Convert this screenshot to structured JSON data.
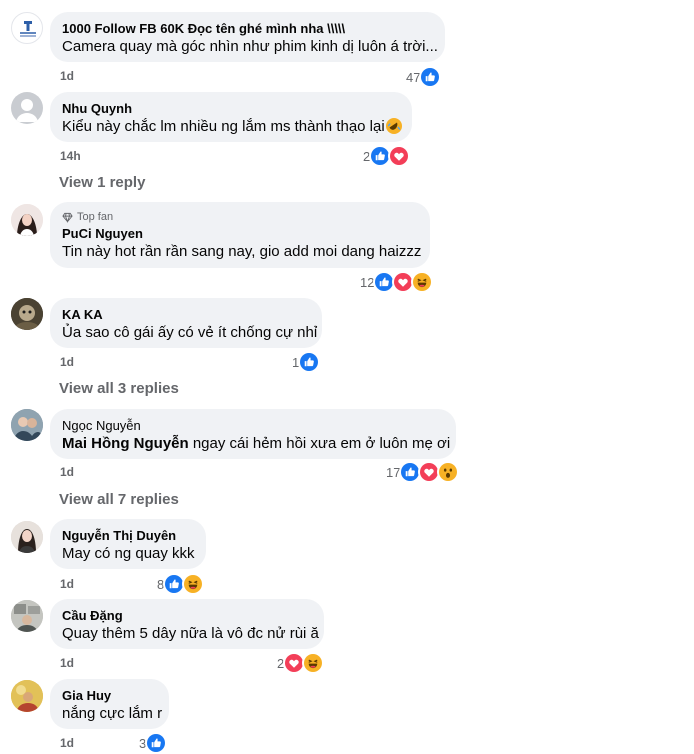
{
  "comments": [
    {
      "author": "1000 Follow FB 60K Đọc tên ghé mình nha \\\\\\\\\\",
      "text": "Camera quay mà góc nhìn như phim kinh dị luôn á trời...",
      "time": "1d",
      "count": "47",
      "avatar": "page-logo"
    },
    {
      "author": "Nhu Quynh",
      "text": "Kiểu này chắc lm nhiều ng lắm ms thành thạo lại",
      "time": "14h",
      "count": "2",
      "avatar": "default-avatar"
    },
    {
      "author": "PuCi Nguyen",
      "badge": "Top fan",
      "text": "Tin này hot rần rần sang nay, gio add moi dang haizzz",
      "time": "",
      "count": "12",
      "avatar": "user-photo"
    },
    {
      "author": "KA KA",
      "text": "Ủa sao cô gái ấy có vẻ ít chống cự nhỉ",
      "time": "1d",
      "count": "1",
      "avatar": "user-photo"
    },
    {
      "author": "Ngọc Nguyễn",
      "mention": "Mai Hồng Nguyễn",
      "text": " ngay cái hẻm hồi xưa em ở luôn mẹ ơi",
      "time": "1d",
      "count": "17",
      "avatar": "user-photo"
    },
    {
      "author": "Nguyễn Thị Duyên",
      "text": "May có ng quay kkk",
      "time": "1d",
      "count": "8",
      "avatar": "user-photo"
    },
    {
      "author": "Cầu Đặng",
      "text": "Quay thêm 5 dây nữa là vô đc nử rùi ă",
      "time": "1d",
      "count": "2",
      "avatar": "user-photo"
    },
    {
      "author": "Gia Huy",
      "text": "nắng cực lắm r",
      "time": "1d",
      "count": "3",
      "avatar": "user-photo"
    }
  ],
  "replies": {
    "r1": "View 1 reply",
    "r2": "View all 3 replies",
    "r3": "View all 7 replies"
  },
  "emoji_after_text": {
    "comment_1": "rolling-laugh-emoji"
  },
  "colors": {
    "like": "#1877f2",
    "love": "#f33e58",
    "haha": "#f7b125",
    "bubble": "#f0f2f5",
    "meta": "#65676b"
  }
}
